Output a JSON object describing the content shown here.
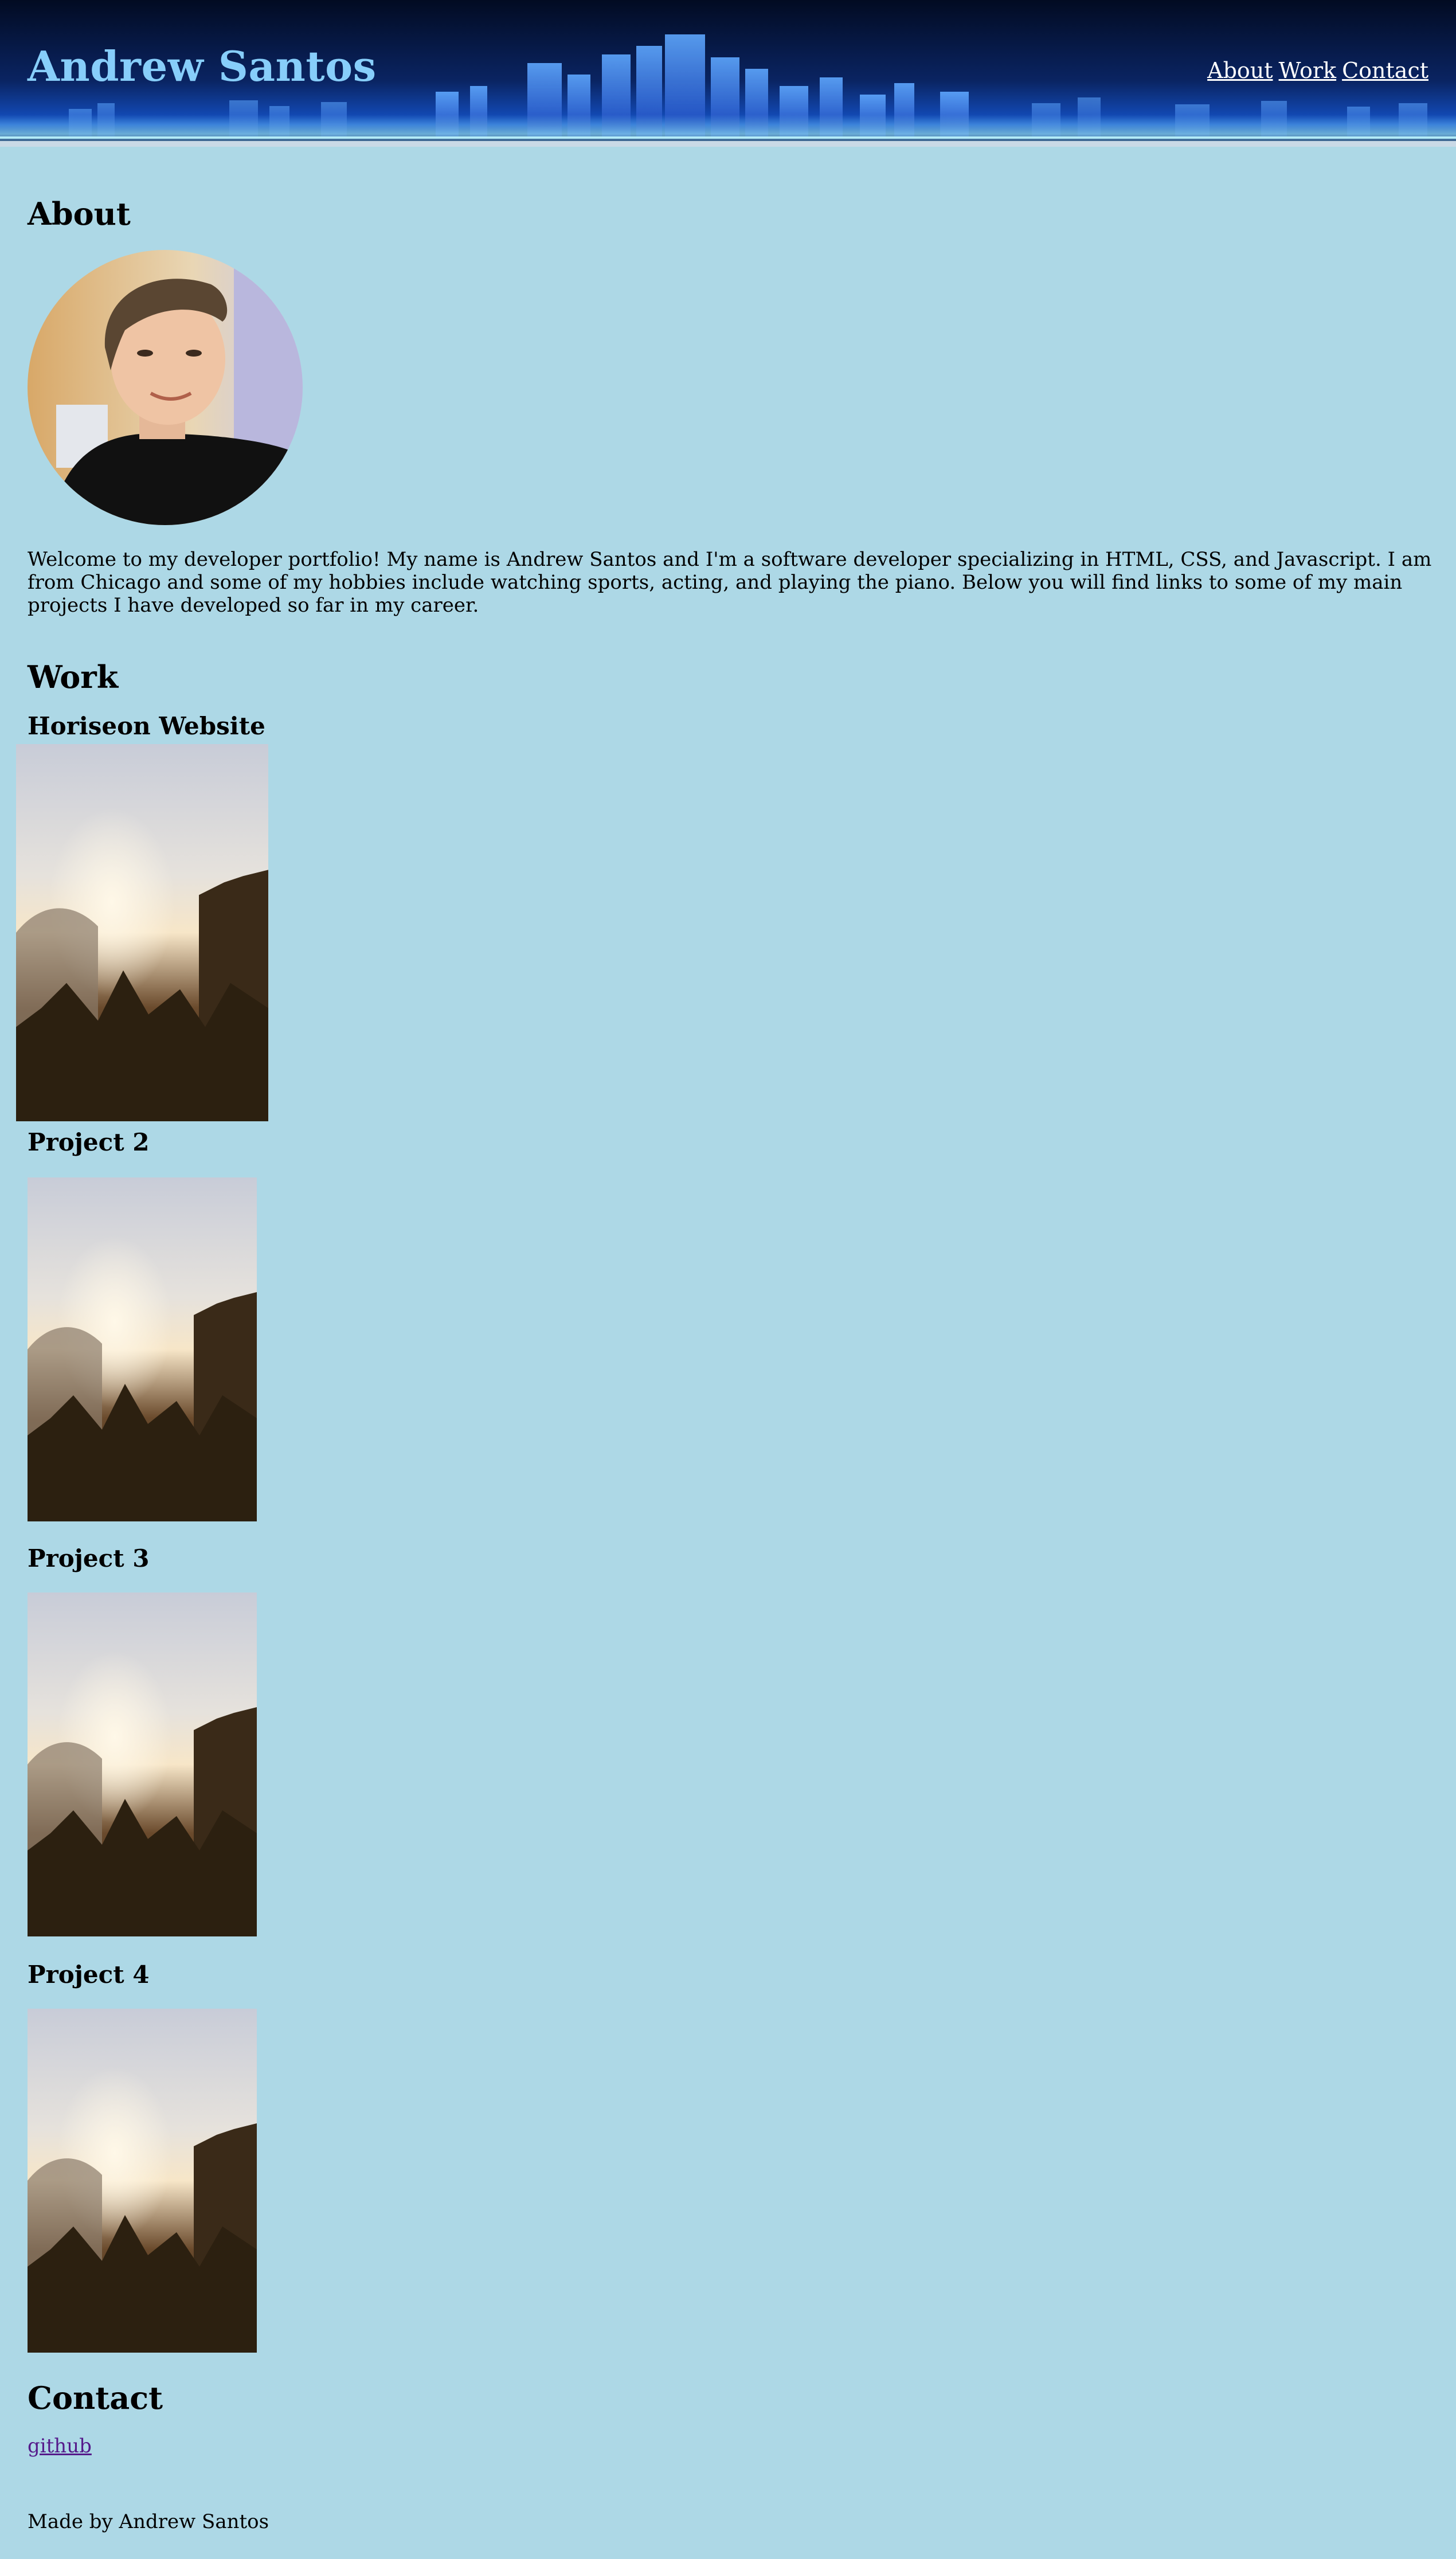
{
  "header": {
    "title": "Andrew Santos",
    "nav": {
      "about": "About",
      "work": "Work",
      "contact": "Contact"
    }
  },
  "about": {
    "heading": "About",
    "text": "Welcome to my developer portfolio! My name is Andrew Santos and I'm a software developer specializing in HTML, CSS, and Javascript. I am from Chicago and some of my hobbies include watching sports, acting, and playing the piano. Below you will find links to some of my main projects I have developed so far in my career."
  },
  "work": {
    "heading": "Work",
    "projects": [
      {
        "title": "Horiseon Website"
      },
      {
        "title": "Project 2"
      },
      {
        "title": "Project 3"
      },
      {
        "title": "Project 4"
      }
    ]
  },
  "contact": {
    "heading": "Contact",
    "github_label": "github"
  },
  "footer": {
    "text": "Made by Andrew Santos"
  },
  "colors": {
    "page_background": "#add8e6",
    "title": "#87cefa",
    "nav_link": "#ffffff",
    "visited_link": "#551a8b"
  }
}
